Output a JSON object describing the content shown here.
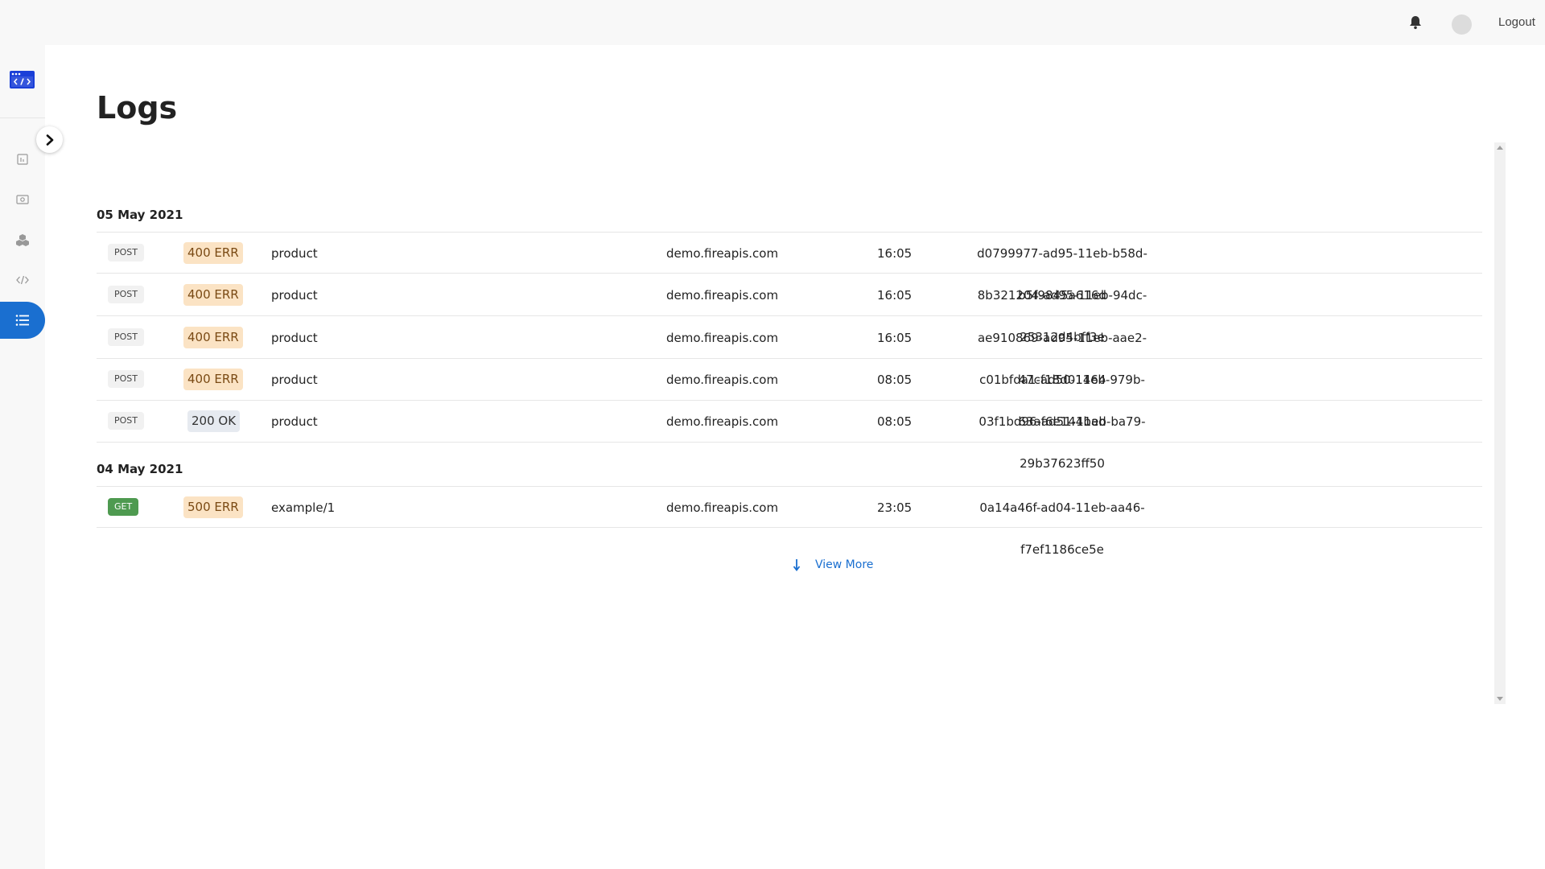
{
  "topbar": {
    "logout_label": "Logout",
    "bell_icon": "bell-icon",
    "avatar_icon": "avatar"
  },
  "sidebar": {
    "logo_icon": "api-logo-icon",
    "toggle_icon": "chevron-right-icon",
    "items": [
      {
        "name": "dashboard",
        "icon": "chart-icon",
        "active": false
      },
      {
        "name": "billing",
        "icon": "money-icon",
        "active": false
      },
      {
        "name": "integrations",
        "icon": "cubes-icon",
        "active": false
      },
      {
        "name": "code",
        "icon": "code-icon",
        "active": false
      },
      {
        "name": "logs",
        "icon": "list-icon",
        "active": true
      }
    ]
  },
  "page": {
    "title": "Logs"
  },
  "groups": [
    {
      "date": "05 May 2021",
      "rows": [
        {
          "method": "POST",
          "status": "400 ERR",
          "status_kind": "err",
          "path": "product",
          "host": "demo.fireapis.com",
          "time": "16:05",
          "id": "d0799977-ad95-11eb-b58d-b5f9845a616d"
        },
        {
          "method": "POST",
          "status": "400 ERR",
          "status_kind": "err",
          "path": "product",
          "host": "demo.fireapis.com",
          "time": "16:05",
          "id": "8b321204-ad95-11eb-94dc-25312d4bff3e"
        },
        {
          "method": "POST",
          "status": "400 ERR",
          "status_kind": "err",
          "path": "product",
          "host": "demo.fireapis.com",
          "time": "16:05",
          "id": "ae910869-ad95-11eb-aae2-47cf18d01464"
        },
        {
          "method": "POST",
          "status": "400 ERR",
          "status_kind": "err",
          "path": "product",
          "host": "demo.fireapis.com",
          "time": "08:05",
          "id": "c01bfda1-ad50-11eb-979b-63af6e144bad"
        },
        {
          "method": "POST",
          "status": "200 OK",
          "status_kind": "ok",
          "path": "product",
          "host": "demo.fireapis.com",
          "time": "08:05",
          "id": "03f1bd96-ad51-11eb-ba79-29b37623ff50"
        }
      ]
    },
    {
      "date": "04 May 2021",
      "rows": [
        {
          "method": "GET",
          "status": "500 ERR",
          "status_kind": "err",
          "path": "example/1",
          "host": "demo.fireapis.com",
          "time": "23:05",
          "id": "0a14a46f-ad04-11eb-aa46-f7ef1186ce5e"
        }
      ]
    }
  ],
  "view_more": {
    "label": "View More",
    "icon": "arrow-down-icon"
  },
  "colors": {
    "accent": "#1a6fd0",
    "err_bg": "#fbe3c4",
    "ok_bg": "#e6eaf0",
    "get_bg": "#4e9a50"
  }
}
